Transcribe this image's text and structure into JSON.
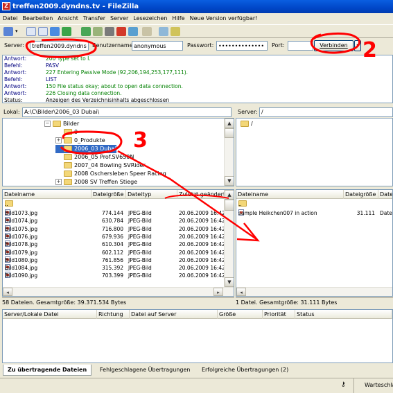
{
  "window": {
    "title": "treffen2009.dyndns.tv - FileZilla"
  },
  "menu": [
    "Datei",
    "Bearbeiten",
    "Ansicht",
    "Transfer",
    "Server",
    "Lesezeichen",
    "Hilfe",
    "Neue Version verfügbar!"
  ],
  "quickconnect": {
    "server_label": "Server:",
    "server_value": "treffen2009.dyndns",
    "user_label": "Benutzername:",
    "user_value": "anonymous",
    "pass_label": "Passwort:",
    "pass_value": "••••••••••••••",
    "port_label": "Port:",
    "port_value": "",
    "connect_label": "Verbinden"
  },
  "log": [
    {
      "label": "Antwort:",
      "text": "200 Type set to I.",
      "color": "#008000"
    },
    {
      "label": "Befehl:",
      "text": "PASV",
      "color": "#000080"
    },
    {
      "label": "Antwort:",
      "text": "227 Entering Passive Mode (92,206,194,253,177,111).",
      "color": "#008000"
    },
    {
      "label": "Befehl:",
      "text": "LIST",
      "color": "#000080"
    },
    {
      "label": "Antwort:",
      "text": "150 File status okay; about to open data connection.",
      "color": "#008000"
    },
    {
      "label": "Antwort:",
      "text": "226 Closing data connection.",
      "color": "#008000"
    },
    {
      "label": "Status:",
      "text": "Anzeigen des Verzeichnisinhalts abgeschlossen",
      "color": "#000000"
    }
  ],
  "local": {
    "path_label": "Lokal:",
    "path": "A:\\C\\Bilder\\2006_03 Dubai\\",
    "tree": [
      {
        "name": "Bilder",
        "indent": 0,
        "expander": "−"
      },
      {
        "name": "0",
        "indent": 1,
        "expander": ""
      },
      {
        "name": "0_Produkte",
        "indent": 1,
        "expander": "+"
      },
      {
        "name": "2006_03 Dubai",
        "indent": 1,
        "expander": "",
        "selected": true
      },
      {
        "name": "2006_05 Prof.SV650N",
        "indent": 1,
        "expander": ""
      },
      {
        "name": "2007_04 Bowling SVRider",
        "indent": 1,
        "expander": ""
      },
      {
        "name": "2008 Oschersleben Speer Racing",
        "indent": 1,
        "expander": ""
      },
      {
        "name": "2008 SV Treffen Stiege",
        "indent": 1,
        "expander": "+"
      }
    ],
    "columns": [
      "Dateiname",
      "Dateigröße",
      "Dateityp",
      "Zuletzt geändert"
    ],
    "parent": "..",
    "files": [
      {
        "name": "Bild1073.jpg",
        "size": "774.144",
        "type": "JPEG-Bild",
        "date": "20.06.2009 16:42"
      },
      {
        "name": "Bild1074.jpg",
        "size": "630.784",
        "type": "JPEG-Bild",
        "date": "20.06.2009 16:42"
      },
      {
        "name": "Bild1075.jpg",
        "size": "716.800",
        "type": "JPEG-Bild",
        "date": "20.06.2009 16:42"
      },
      {
        "name": "Bild1076.jpg",
        "size": "679.936",
        "type": "JPEG-Bild",
        "date": "20.06.2009 16:42"
      },
      {
        "name": "Bild1078.jpg",
        "size": "610.304",
        "type": "JPEG-Bild",
        "date": "20.06.2009 16:42"
      },
      {
        "name": "Bild1079.jpg",
        "size": "602.112",
        "type": "JPEG-Bild",
        "date": "20.06.2009 16:42"
      },
      {
        "name": "Bild1080.jpg",
        "size": "761.856",
        "type": "JPEG-Bild",
        "date": "20.06.2009 16:42"
      },
      {
        "name": "Bild1084.jpg",
        "size": "315.392",
        "type": "JPEG-Bild",
        "date": "20.06.2009 16:42"
      },
      {
        "name": "Bild1090.jpg",
        "size": "703.399",
        "type": "JPEG-Bild",
        "date": "20.06.2009 16:42"
      }
    ],
    "status": "58 Dateien. Gesamtgröße: 39.371.534 Bytes"
  },
  "remote": {
    "path_label": "Server:",
    "path": "/",
    "tree_root": "/",
    "columns": [
      "Dateiname",
      "Dateigröße",
      "Datei"
    ],
    "parent": "..",
    "files": [
      {
        "name": "sample Heikchen007 in action",
        "size": "31.111",
        "type": "Datei"
      }
    ],
    "status": "1 Datei. Gesamtgröße: 31.111 Bytes"
  },
  "queue": {
    "columns": [
      "Server/Lokale Datei",
      "Richtung",
      "Datei auf Server",
      "Größe",
      "Priorität",
      "Status"
    ]
  },
  "tabs": [
    "Zu übertragende Dateien",
    "Fehlgeschlagene Übertragungen",
    "Erfolgreiche Übertragungen (2)"
  ],
  "footer": {
    "queue_label": "Warteschla"
  },
  "annotations": {
    "labels": [
      "2",
      "3"
    ],
    "color": "#ff0000"
  }
}
